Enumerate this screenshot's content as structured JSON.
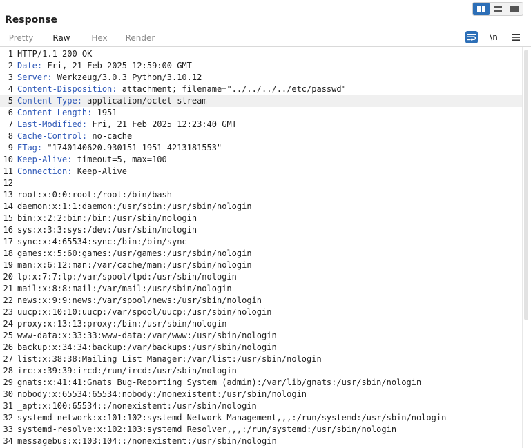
{
  "title": "Response",
  "layout_toggle": {
    "icons": [
      "split-columns-icon",
      "split-rows-icon",
      "single-panel-icon"
    ],
    "active_index": 0
  },
  "tabs": [
    {
      "label": "Pretty",
      "active": false
    },
    {
      "label": "Raw",
      "active": true
    },
    {
      "label": "Hex",
      "active": false
    },
    {
      "label": "Render",
      "active": false
    }
  ],
  "tools": {
    "wrap_icon": "word-wrap-icon",
    "newline_label": "\\n",
    "menu_icon": "hamburger-menu-icon"
  },
  "colors": {
    "accent": "#e8622c",
    "header_key": "#2d57b7",
    "active_button": "#2d6fb7"
  },
  "highlighted_line": 5,
  "headers": [
    {
      "n": "1",
      "key": "",
      "value": "HTTP/1.1 200 OK"
    },
    {
      "n": "2",
      "key": "Date:",
      "value": " Fri, 21 Feb 2025 12:59:00 GMT"
    },
    {
      "n": "3",
      "key": "Server:",
      "value": " Werkzeug/3.0.3 Python/3.10.12"
    },
    {
      "n": "4",
      "key": "Content-Disposition:",
      "value": " attachment; filename=\"../../../../etc/passwd\""
    },
    {
      "n": "5",
      "key": "Content-Type:",
      "value": " application/octet-stream"
    },
    {
      "n": "6",
      "key": "Content-Length:",
      "value": " 1951"
    },
    {
      "n": "7",
      "key": "Last-Modified:",
      "value": " Fri, 21 Feb 2025 12:23:40 GMT"
    },
    {
      "n": "8",
      "key": "Cache-Control:",
      "value": " no-cache"
    },
    {
      "n": "9",
      "key": "ETag:",
      "value": " \"1740140620.930151-1951-4213181553\""
    },
    {
      "n": "10",
      "key": "Keep-Alive:",
      "value": " timeout=5, max=100"
    },
    {
      "n": "11",
      "key": "Connection:",
      "value": " Keep-Alive"
    },
    {
      "n": "12",
      "key": "",
      "value": ""
    }
  ],
  "body_lines": [
    {
      "n": "13",
      "text": "root:x:0:0:root:/root:/bin/bash"
    },
    {
      "n": "14",
      "text": "daemon:x:1:1:daemon:/usr/sbin:/usr/sbin/nologin"
    },
    {
      "n": "15",
      "text": "bin:x:2:2:bin:/bin:/usr/sbin/nologin"
    },
    {
      "n": "16",
      "text": "sys:x:3:3:sys:/dev:/usr/sbin/nologin"
    },
    {
      "n": "17",
      "text": "sync:x:4:65534:sync:/bin:/bin/sync"
    },
    {
      "n": "18",
      "text": "games:x:5:60:games:/usr/games:/usr/sbin/nologin"
    },
    {
      "n": "19",
      "text": "man:x:6:12:man:/var/cache/man:/usr/sbin/nologin"
    },
    {
      "n": "20",
      "text": "lp:x:7:7:lp:/var/spool/lpd:/usr/sbin/nologin"
    },
    {
      "n": "21",
      "text": "mail:x:8:8:mail:/var/mail:/usr/sbin/nologin"
    },
    {
      "n": "22",
      "text": "news:x:9:9:news:/var/spool/news:/usr/sbin/nologin"
    },
    {
      "n": "23",
      "text": "uucp:x:10:10:uucp:/var/spool/uucp:/usr/sbin/nologin"
    },
    {
      "n": "24",
      "text": "proxy:x:13:13:proxy:/bin:/usr/sbin/nologin"
    },
    {
      "n": "25",
      "text": "www-data:x:33:33:www-data:/var/www:/usr/sbin/nologin"
    },
    {
      "n": "26",
      "text": "backup:x:34:34:backup:/var/backups:/usr/sbin/nologin"
    },
    {
      "n": "27",
      "text": "list:x:38:38:Mailing List Manager:/var/list:/usr/sbin/nologin"
    },
    {
      "n": "28",
      "text": "irc:x:39:39:ircd:/run/ircd:/usr/sbin/nologin"
    },
    {
      "n": "29",
      "text": "gnats:x:41:41:Gnats Bug-Reporting System (admin):/var/lib/gnats:/usr/sbin/nologin"
    },
    {
      "n": "30",
      "text": "nobody:x:65534:65534:nobody:/nonexistent:/usr/sbin/nologin"
    },
    {
      "n": "31",
      "text": "_apt:x:100:65534::/nonexistent:/usr/sbin/nologin"
    },
    {
      "n": "32",
      "text": "systemd-network:x:101:102:systemd Network Management,,,:/run/systemd:/usr/sbin/nologin"
    },
    {
      "n": "33",
      "text": "systemd-resolve:x:102:103:systemd Resolver,,,:/run/systemd:/usr/sbin/nologin"
    },
    {
      "n": "34",
      "text": "messagebus:x:103:104::/nonexistent:/usr/sbin/nologin"
    }
  ]
}
